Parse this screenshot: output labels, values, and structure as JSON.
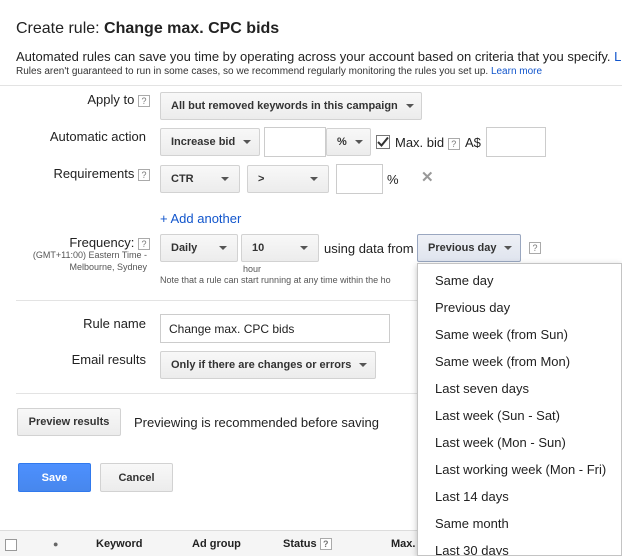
{
  "header": {
    "title_prefix": "Create rule: ",
    "title_name": "Change max. CPC bids",
    "intro": "Automated rules can save you time by operating across your account based on criteria that you specify.",
    "intro_link": "L",
    "note": "Rules aren't guaranteed to run in some cases, so we recommend regularly monitoring the rules you set up.",
    "note_link": "Learn more"
  },
  "help_glyph": "?",
  "apply_to": {
    "label": "Apply to",
    "value": "All but removed keywords in this campaign"
  },
  "automatic_action": {
    "label": "Automatic action",
    "action": "Increase bid",
    "amount": "",
    "unit": "%",
    "max_bid_checked": true,
    "max_bid_label": "Max. bid",
    "currency": "A$",
    "max_bid_value": ""
  },
  "requirements": {
    "label": "Requirements",
    "metric": "CTR",
    "operator": ">",
    "value": "",
    "unit": "%",
    "remove_glyph": "✕"
  },
  "add_another": "+ Add another",
  "frequency": {
    "label": "Frequency:",
    "timezone": "(GMT+11:00) Eastern Time -",
    "timezone_2": "Melbourne, Sydney",
    "period": "Daily",
    "hour": "10",
    "hour_caption": "hour",
    "using_data_from": "using data from",
    "data_range": "Previous day",
    "note": "Note that a rule can start running at any time within the ho"
  },
  "rule_name": {
    "label": "Rule name",
    "value": "Change max. CPC bids"
  },
  "email_results": {
    "label": "Email results",
    "value": "Only if there are changes or errors"
  },
  "preview": {
    "button": "Preview results",
    "text": "Previewing is recommended before saving"
  },
  "actions": {
    "save": "Save",
    "cancel": "Cancel"
  },
  "dropdown_options": [
    "Same day",
    "Previous day",
    "Same week (from Sun)",
    "Same week (from Mon)",
    "Last seven days",
    "Last week (Sun - Sat)",
    "Last week (Mon - Sun)",
    "Last working week (Mon - Fri)",
    "Last 14 days",
    "Same month",
    "Last 30 days"
  ],
  "table": {
    "dot": "●",
    "columns": [
      "Keyword",
      "Ad group",
      "Status",
      "Max."
    ]
  },
  "colors": {
    "primary": "#4d90fe",
    "link": "#1155cc"
  },
  "icons": {
    "checkmark": "checkmark-icon",
    "remove": "close-icon",
    "caret": "chevron-down-icon"
  }
}
